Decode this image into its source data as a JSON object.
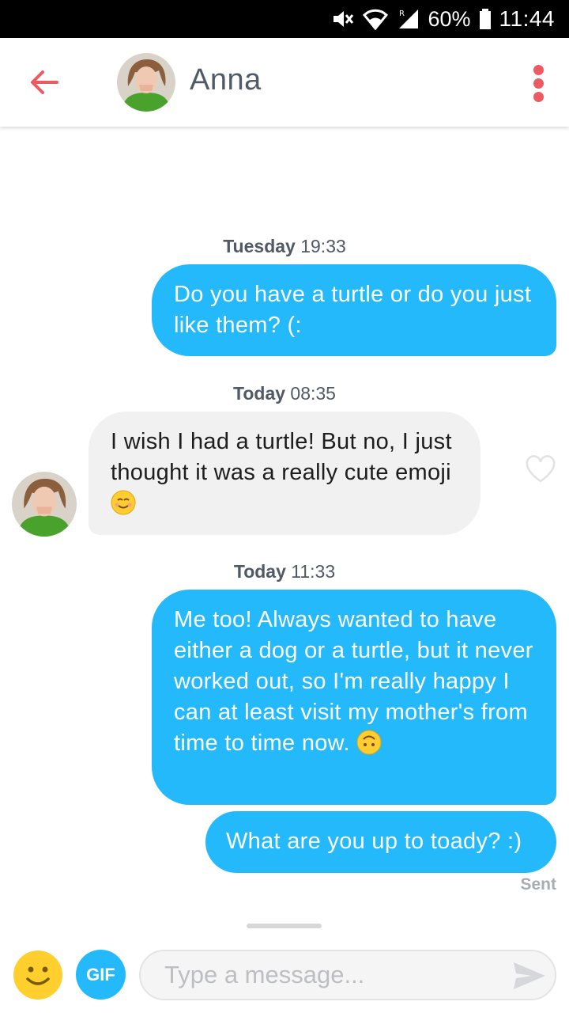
{
  "status_bar": {
    "battery": "60%",
    "time": "11:44",
    "icons": [
      "mute-icon",
      "wifi-icon",
      "signal-icon",
      "battery-icon"
    ]
  },
  "header": {
    "name": "Anna",
    "back_icon": "back-arrow-icon",
    "menu_icon": "kebab-menu-icon",
    "accent_color": "#ee5a61"
  },
  "messages": [
    {
      "direction": "out",
      "day": "Tuesday",
      "time": "19:33",
      "text": "Do you have a turtle or do you just like them? (:"
    },
    {
      "direction": "in",
      "day": "Today",
      "time": "08:35",
      "text": "I wish I had a turtle! But no, I just thought it was a really cute emoji",
      "emoji": "smiling-face-icon"
    },
    {
      "direction": "out",
      "day": "Today",
      "time": "11:33",
      "text": "Me too! Always wanted to have either a dog or a turtle, but it never worked out, so I'm really happy I can at least visit my mother's from time to time now.",
      "emoji": "upside-down-face-icon"
    },
    {
      "direction": "out",
      "text": "What are you up to toady? :)",
      "status": "Sent"
    }
  ],
  "composer": {
    "gif_label": "GIF",
    "placeholder": "Type a message...",
    "value": ""
  },
  "colors": {
    "outgoing_bubble": "#24b9fb",
    "incoming_bubble": "#f1f1f1",
    "accent": "#ee5a61"
  }
}
